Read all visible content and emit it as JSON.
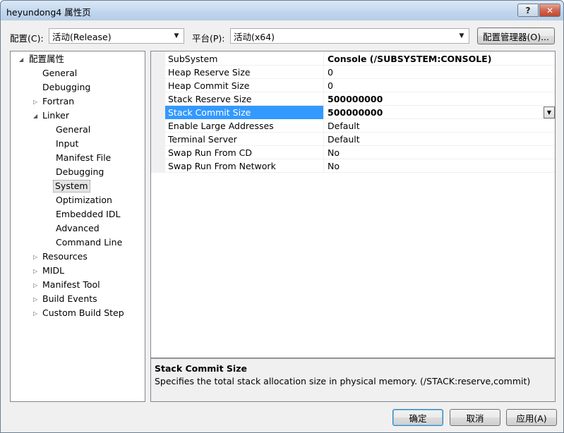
{
  "window": {
    "title": "heyundong4 属性页",
    "help_label": "?",
    "close_label": "✕"
  },
  "config": {
    "config_label": "配置(C):",
    "config_value": "活动(Release)",
    "platform_label": "平台(P):",
    "platform_value": "活动(x64)",
    "manager_label": "配置管理器(O)..."
  },
  "tree": {
    "root": "配置属性",
    "items": [
      {
        "label": "General"
      },
      {
        "label": "Debugging"
      },
      {
        "label": "Fortran"
      },
      {
        "label": "Linker"
      },
      {
        "label": "General"
      },
      {
        "label": "Input"
      },
      {
        "label": "Manifest File"
      },
      {
        "label": "Debugging"
      },
      {
        "label": "System"
      },
      {
        "label": "Optimization"
      },
      {
        "label": "Embedded IDL"
      },
      {
        "label": "Advanced"
      },
      {
        "label": "Command Line"
      },
      {
        "label": "Resources"
      },
      {
        "label": "MIDL"
      },
      {
        "label": "Manifest Tool"
      },
      {
        "label": "Build Events"
      },
      {
        "label": "Custom Build Step"
      }
    ]
  },
  "grid": {
    "rows": [
      {
        "name": "SubSystem",
        "value": "Console (/SUBSYSTEM:CONSOLE)"
      },
      {
        "name": "Heap Reserve Size",
        "value": "0"
      },
      {
        "name": "Heap Commit Size",
        "value": "0"
      },
      {
        "name": "Stack Reserve Size",
        "value": "500000000"
      },
      {
        "name": "Stack Commit Size",
        "value": "500000000"
      },
      {
        "name": "Enable Large Addresses",
        "value": "Default"
      },
      {
        "name": "Terminal Server",
        "value": "Default"
      },
      {
        "name": "Swap Run From CD",
        "value": "No"
      },
      {
        "name": "Swap Run From Network",
        "value": "No"
      }
    ]
  },
  "description": {
    "title": "Stack Commit Size",
    "text": "Specifies the total stack allocation size in physical memory. (/STACK:reserve,commit)"
  },
  "buttons": {
    "ok": "确定",
    "cancel": "取消",
    "apply": "应用(A)"
  },
  "colors": {
    "selection": "#3399ff",
    "dialog_bg": "#f0f0f0"
  }
}
